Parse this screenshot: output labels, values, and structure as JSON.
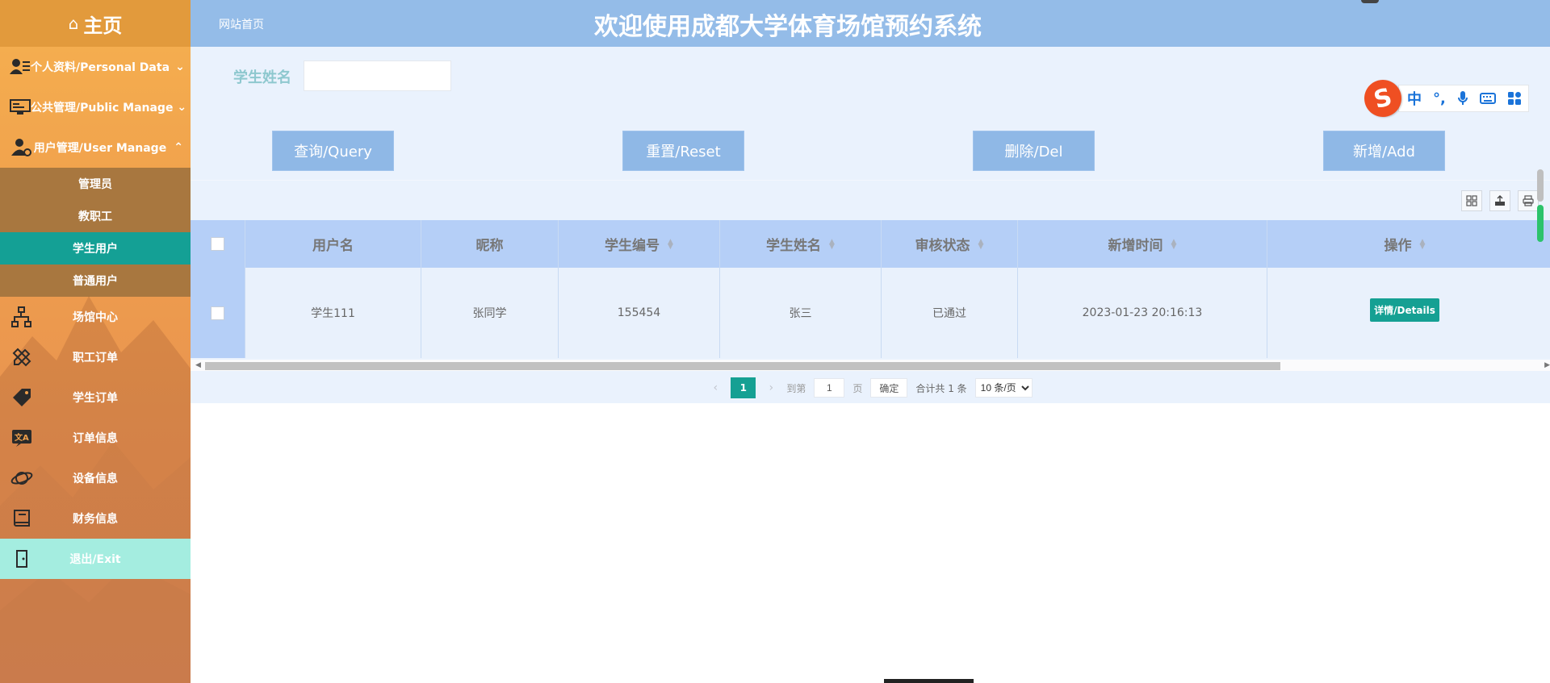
{
  "sidebar": {
    "home_label": "主页",
    "groups": [
      {
        "label": "个人资料/Personal Data",
        "expanded": false
      },
      {
        "label": "公共管理/Public Manage",
        "expanded": false
      },
      {
        "label": "用户管理/User Manage",
        "expanded": true
      }
    ],
    "submenu": [
      "管理员",
      "教职工",
      "学生用户",
      "普通用户"
    ],
    "active_submenu": "学生用户",
    "items": [
      {
        "label": "场馆中心",
        "icon": "sitemap-icon"
      },
      {
        "label": "职工订单",
        "icon": "pencil-ruler-icon"
      },
      {
        "label": "学生订单",
        "icon": "tags-icon"
      },
      {
        "label": "订单信息",
        "icon": "translate-icon"
      },
      {
        "label": "设备信息",
        "icon": "planet-icon"
      },
      {
        "label": "财务信息",
        "icon": "book-icon"
      },
      {
        "label": "退出/Exit",
        "icon": "door-exit-icon"
      }
    ]
  },
  "header": {
    "breadcrumb": "网站首页",
    "title": "欢迎使用成都大学体育场馆预约系统"
  },
  "search": {
    "label": "学生姓名",
    "value": ""
  },
  "buttons": {
    "query": "查询/Query",
    "reset": "重置/Reset",
    "delete": "删除/Del",
    "add": "新增/Add"
  },
  "toolbar_icons": [
    "grid-icon",
    "export-icon",
    "print-icon"
  ],
  "table": {
    "columns": [
      "用户名",
      "昵称",
      "学生编号",
      "学生姓名",
      "审核状态",
      "新增时间",
      "操作"
    ],
    "sortable": [
      false,
      false,
      true,
      true,
      true,
      true,
      true
    ],
    "rows": [
      {
        "username": "学生111",
        "nickname": "张同学",
        "student_no": "155454",
        "student_name": "张三",
        "status": "已通过",
        "created": "2023-01-23 20:16:13",
        "action": "详情/Details"
      }
    ]
  },
  "pagination": {
    "current_page": "1",
    "goto_prefix": "到第",
    "goto_value": "1",
    "goto_suffix": "页",
    "confirm": "确定",
    "total": "合计共 1 条",
    "page_size": "10 条/页"
  },
  "ime": {
    "logo": "S",
    "mode": "中",
    "punct": "°,"
  },
  "colors": {
    "header_bg": "#94bce8",
    "button_bg": "#8fb8e6",
    "accent_teal": "#15a093",
    "sidebar_orange": "#f0a04c",
    "table_header": "#b5cff7"
  }
}
